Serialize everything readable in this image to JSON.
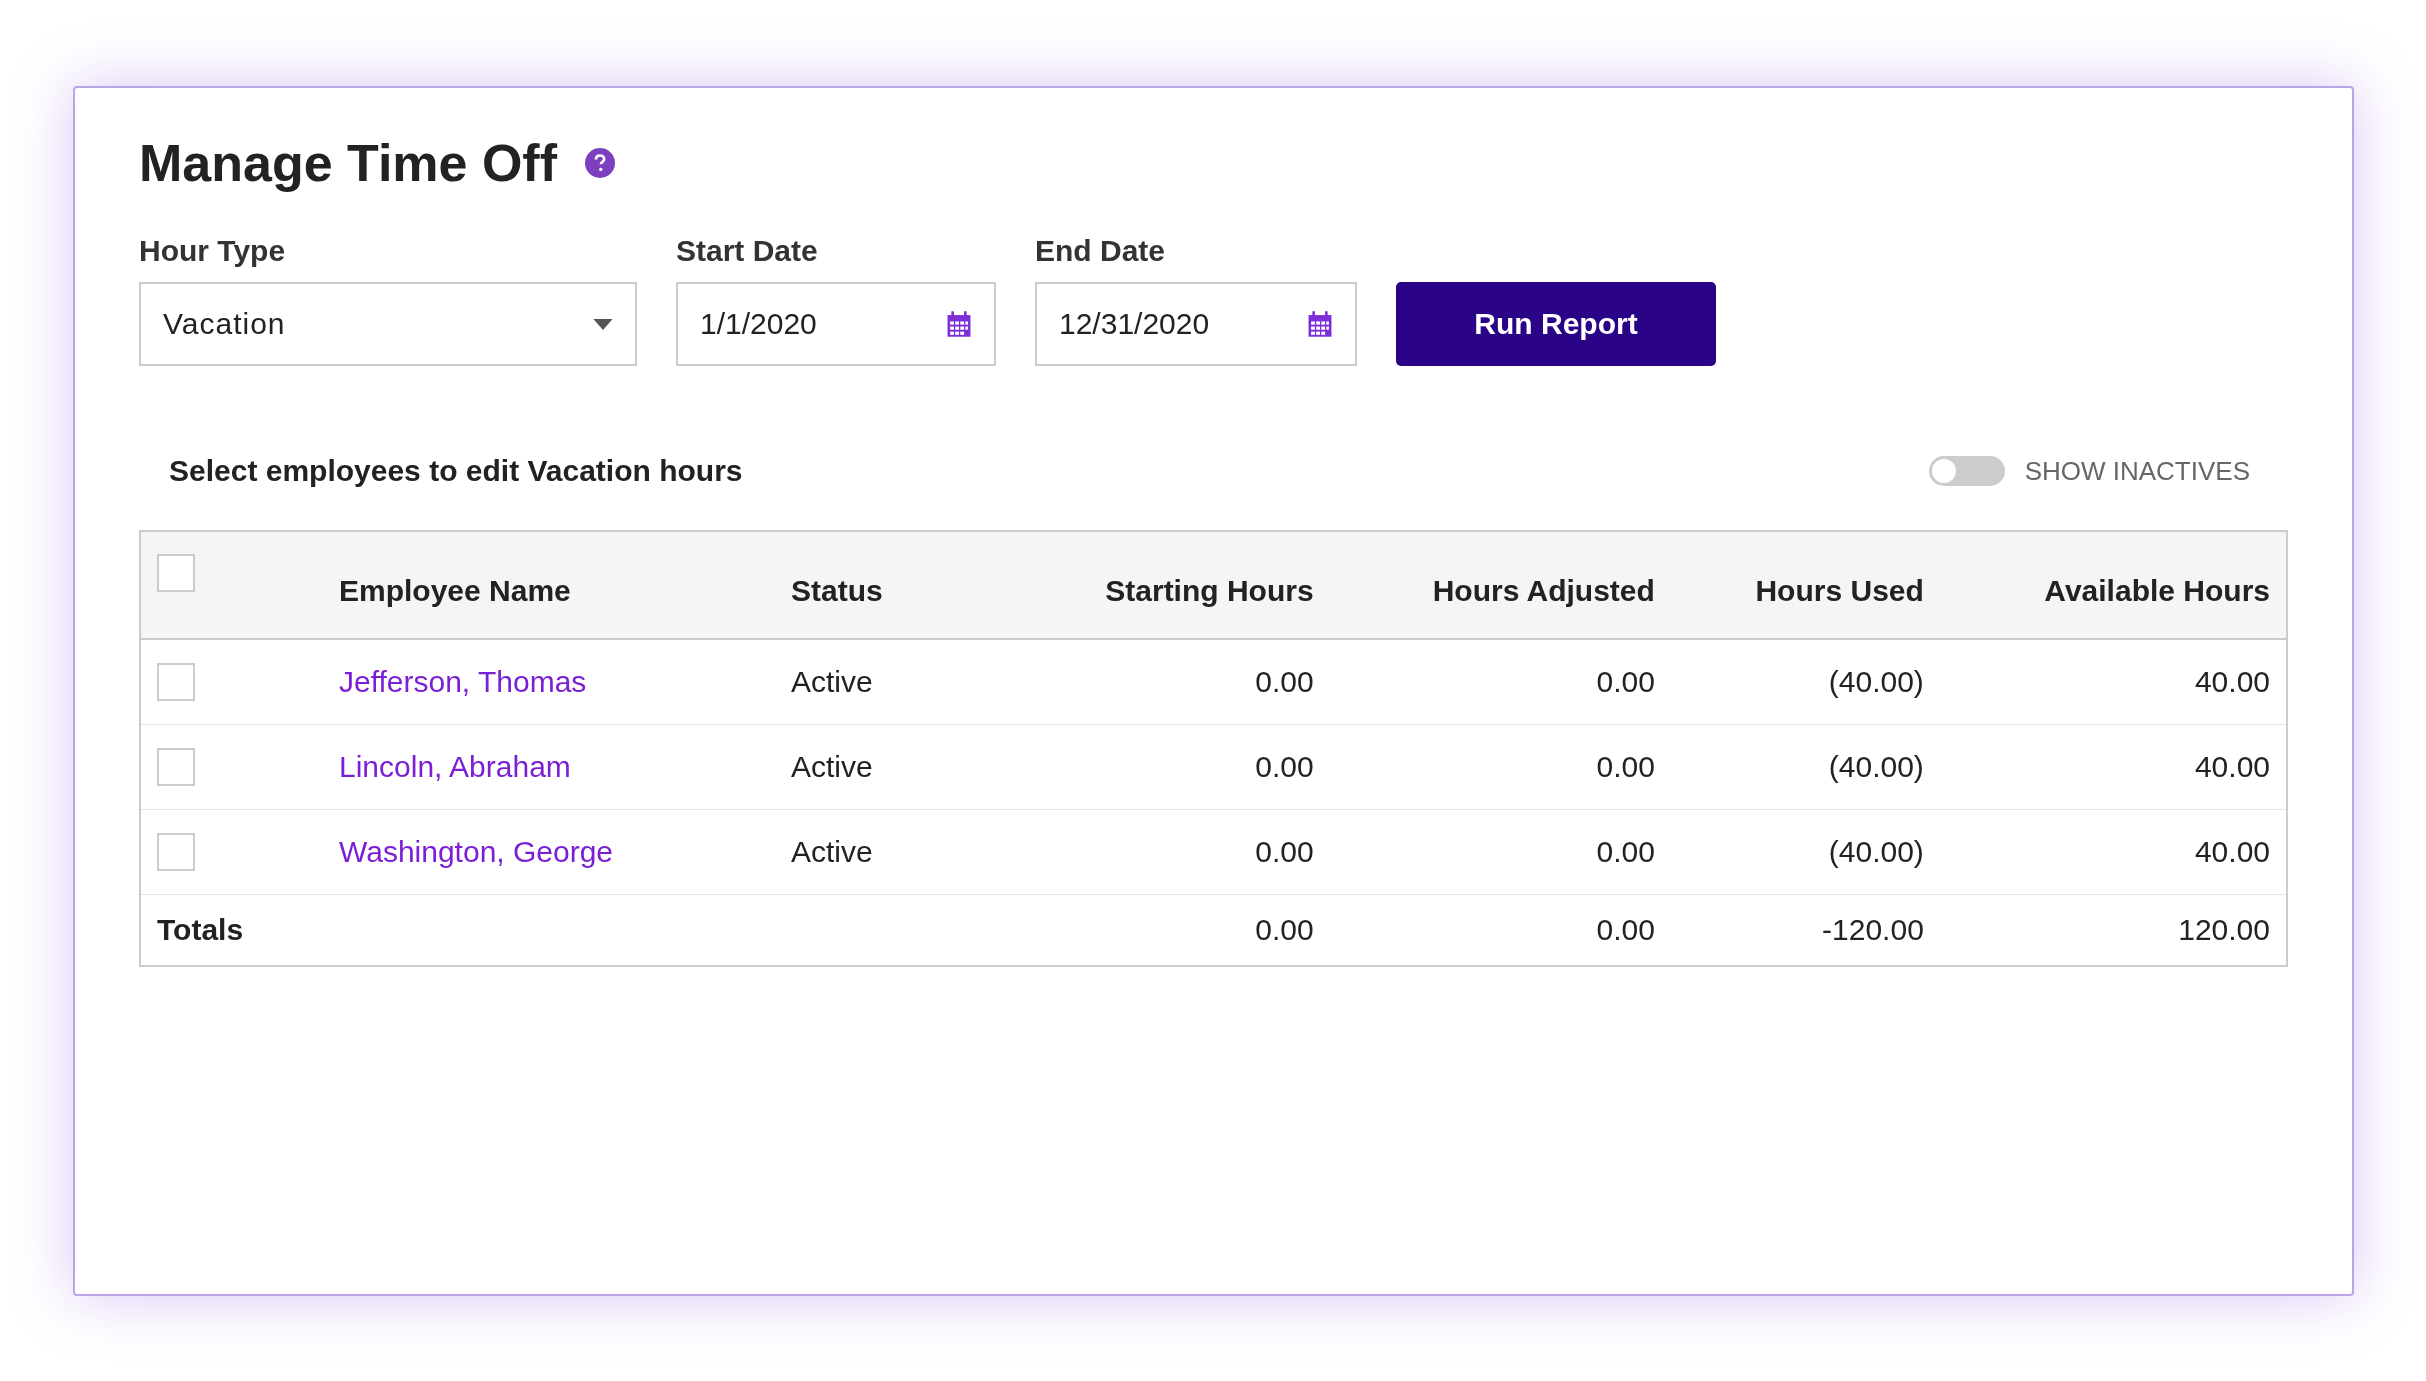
{
  "title": "Manage Time Off",
  "filters": {
    "hour_type": {
      "label": "Hour Type",
      "value": "Vacation"
    },
    "start_date": {
      "label": "Start Date",
      "value": "1/1/2020"
    },
    "end_date": {
      "label": "End Date",
      "value": "12/31/2020"
    },
    "run_button": "Run Report"
  },
  "section_heading": "Select employees to edit Vacation hours",
  "show_inactives": {
    "label": "SHOW INACTIVES",
    "on": false
  },
  "table": {
    "select_all": {
      "checked": false
    },
    "columns": [
      "Employee Name",
      "Status",
      "Starting Hours",
      "Hours Adjusted",
      "Hours Used",
      "Available Hours"
    ],
    "rows": [
      {
        "checked": false,
        "cells": [
          "Jefferson, Thomas",
          "Active",
          "0.00",
          "0.00",
          "(40.00)",
          "40.00"
        ]
      },
      {
        "checked": false,
        "cells": [
          "Lincoln, Abraham",
          "Active",
          "0.00",
          "0.00",
          "(40.00)",
          "40.00"
        ]
      },
      {
        "checked": false,
        "cells": [
          "Washington, George",
          "Active",
          "0.00",
          "0.00",
          "(40.00)",
          "40.00"
        ]
      }
    ],
    "totals": {
      "label": "Totals",
      "cells": [
        "0.00",
        "0.00",
        "-120.00",
        "120.00"
      ]
    }
  }
}
